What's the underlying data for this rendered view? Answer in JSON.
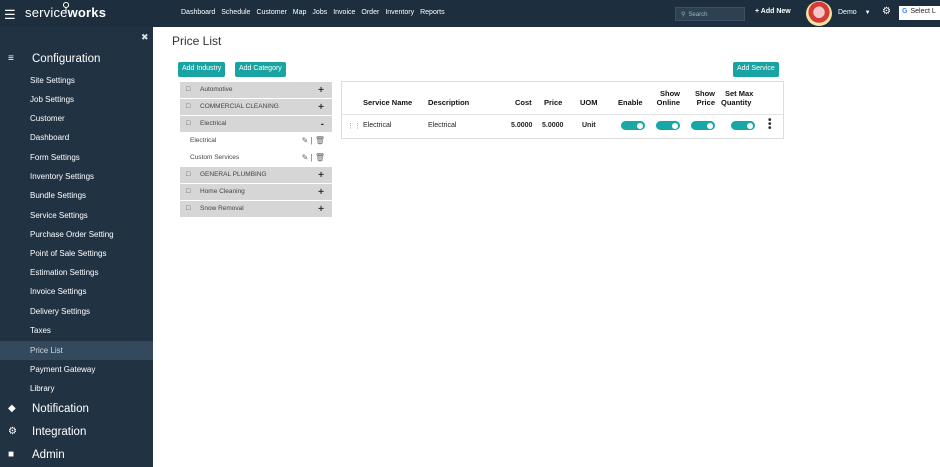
{
  "topbar": {
    "brand_light": "service",
    "brand_bold": "works",
    "nav": [
      "Dashboard",
      "Schedule",
      "Customer",
      "Map",
      "Jobs",
      "Invoice",
      "Order",
      "Inventory",
      "Reports"
    ],
    "search_placeholder": "Search",
    "add_new": "Add New",
    "user": "Demo",
    "translate": "Select L"
  },
  "sidebar": {
    "sections": {
      "configuration": "Configuration",
      "notification": "Notification",
      "integration": "Integration",
      "admin": "Admin"
    },
    "items": [
      "Site Settings",
      "Job Settings",
      "Customer",
      "Dashboard",
      "Form Settings",
      "Inventory Settings",
      "Bundle Settings",
      "Service Settings",
      "Purchase Order Setting",
      "Point of Sale Settings",
      "Estimation Settings",
      "Invoice Settings",
      "Delivery Settings",
      "Taxes",
      "Price List",
      "Payment Gateway",
      "Library"
    ],
    "active_item": "Price List"
  },
  "main": {
    "title": "Price List",
    "add_industry": "Add Industry",
    "add_category": "Add Category",
    "add_service": "Add Service",
    "categories": [
      {
        "label": "Automotive",
        "toggle": "+"
      },
      {
        "label": "COMMERCIAL CLEANING",
        "toggle": "+"
      },
      {
        "label": "Electrical",
        "toggle": "-"
      },
      {
        "label": "GENERAL PLUMBING",
        "toggle": "+"
      },
      {
        "label": "Home Cleaning",
        "toggle": "+"
      },
      {
        "label": "Snow Removal",
        "toggle": "+"
      }
    ],
    "subcategories": [
      "Electrical",
      "Custom Services"
    ],
    "table": {
      "headers": {
        "service_name": "Service Name",
        "description": "Description",
        "cost": "Cost",
        "price": "Price",
        "uom": "UOM",
        "enable": "Enable",
        "show_online": "Show Online",
        "show_online_1": "Show",
        "show_online_2": "Online",
        "show_price_1": "Show",
        "show_price_2": "Price",
        "set_max_1": "Set Max",
        "set_max_2": "Quantity"
      },
      "rows": [
        {
          "service_name": "Electrical",
          "description": "Electrical",
          "cost": "5.0000",
          "price": "5.0000",
          "uom": "Unit",
          "enable": true,
          "show_online": true,
          "show_price": true,
          "set_max_quantity": true
        }
      ]
    }
  },
  "colors": {
    "topbar": "#1d2f3f",
    "sidebar": "#213243",
    "accent": "#1aa3a3"
  }
}
